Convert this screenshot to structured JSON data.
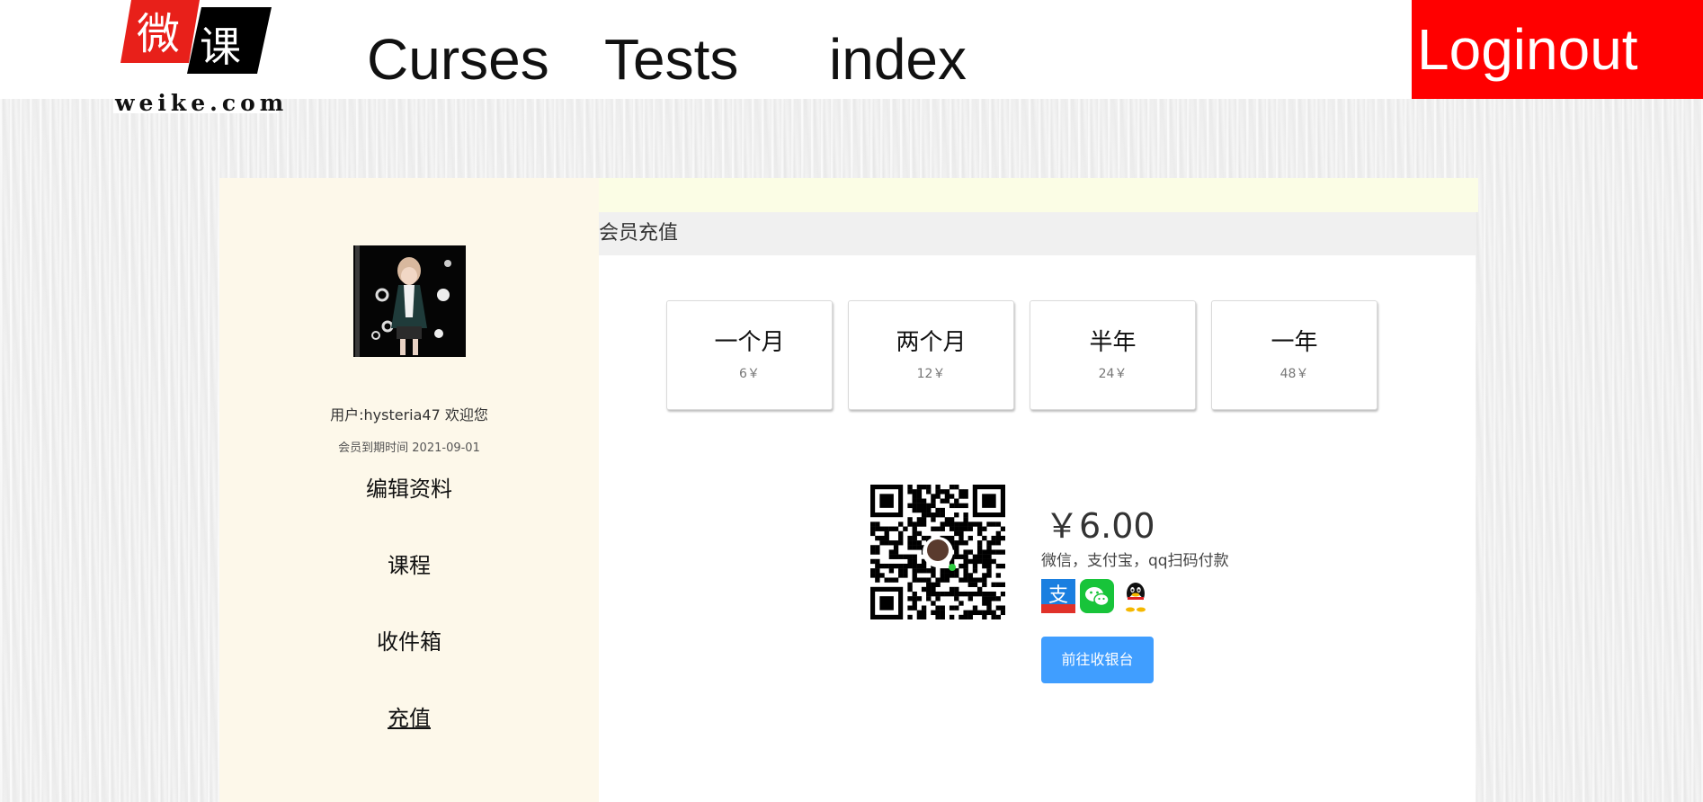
{
  "header": {
    "logo": {
      "chars": [
        "微",
        "课"
      ],
      "site": "weike.com"
    },
    "nav": [
      {
        "label": "Curses"
      },
      {
        "label": "Tests"
      },
      {
        "label": "index"
      }
    ],
    "logout_label": "Loginout",
    "logout_color": "#ff0000"
  },
  "sidebar": {
    "user_greeting": "用户:hysteria47 欢迎您",
    "membership_expiry": "会员到期时间 2021-09-01",
    "links": [
      {
        "label": "编辑资料"
      },
      {
        "label": "课程"
      },
      {
        "label": "收件箱"
      },
      {
        "label": "充值",
        "active": true
      }
    ]
  },
  "main": {
    "section_title": "会员充值",
    "plans": [
      {
        "name": "一个月",
        "price": "6￥"
      },
      {
        "name": "两个月",
        "price": "12￥"
      },
      {
        "name": "半年",
        "price": "24￥"
      },
      {
        "name": "一年",
        "price": "48￥"
      }
    ],
    "payment": {
      "amount": "￥6.00",
      "description": "微信，支付宝，qq扫码付款",
      "icons": [
        "alipay-icon",
        "wechat-pay-icon",
        "qq-icon"
      ],
      "checkout_label": "前往收银台",
      "checkout_color": "#409eff"
    }
  }
}
